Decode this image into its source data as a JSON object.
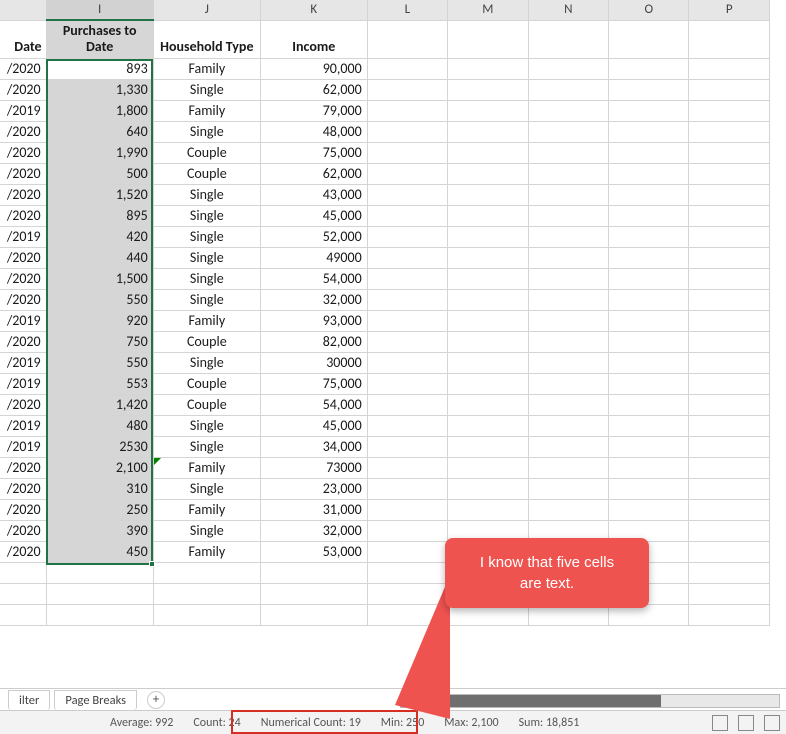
{
  "column_headers": [
    "I",
    "J",
    "K",
    "L",
    "M",
    "N",
    "O",
    "P"
  ],
  "selected_column": "I",
  "data_headers": {
    "date": "Date",
    "purchases": "Purchases to Date",
    "household": "Household Type",
    "income": "Income"
  },
  "rows": [
    {
      "date": "/2020",
      "p": "893",
      "h": "Family",
      "i": "90,000"
    },
    {
      "date": "/2020",
      "p": "1,330",
      "h": "Single",
      "i": "62,000"
    },
    {
      "date": "/2019",
      "p": "1,800",
      "h": "Family",
      "i": "79,000"
    },
    {
      "date": "/2020",
      "p": "640",
      "h": "Single",
      "i": "48,000"
    },
    {
      "date": "/2020",
      "p": "1,990",
      "h": "Couple",
      "i": "75,000"
    },
    {
      "date": "/2020",
      "p": "500",
      "h": "Couple",
      "i": "62,000"
    },
    {
      "date": "/2020",
      "p": "1,520",
      "h": "Single",
      "i": "43,000"
    },
    {
      "date": "/2020",
      "p": "895",
      "h": "Single",
      "i": "45,000"
    },
    {
      "date": "/2019",
      "p": "420",
      "h": "Single",
      "i": "52,000"
    },
    {
      "date": "/2020",
      "p": "440",
      "h": "Single",
      "i": "49000"
    },
    {
      "date": "/2020",
      "p": "1,500",
      "h": "Single",
      "i": "54,000"
    },
    {
      "date": "/2020",
      "p": "550",
      "h": "Single",
      "i": "32,000"
    },
    {
      "date": "/2019",
      "p": "920",
      "h": "Family",
      "i": "93,000"
    },
    {
      "date": "/2020",
      "p": "750",
      "h": "Couple",
      "i": "82,000"
    },
    {
      "date": "/2019",
      "p": "550",
      "h": "Single",
      "i": "30000"
    },
    {
      "date": "/2019",
      "p": "553",
      "h": "Couple",
      "i": "75,000"
    },
    {
      "date": "/2020",
      "p": "1,420",
      "h": "Couple",
      "i": "54,000"
    },
    {
      "date": "/2019",
      "p": "480",
      "h": "Single",
      "i": "45,000"
    },
    {
      "date": "/2019",
      "p": "2530",
      "h": "Single",
      "i": "34,000"
    },
    {
      "date": "/2020",
      "p": "2,100",
      "h": "Family",
      "i": "73000",
      "err": true
    },
    {
      "date": "/2020",
      "p": "310",
      "h": "Single",
      "i": "23,000"
    },
    {
      "date": "/2020",
      "p": "250",
      "h": "Family",
      "i": "31,000"
    },
    {
      "date": "/2020",
      "p": "390",
      "h": "Single",
      "i": "32,000"
    },
    {
      "date": "/2020",
      "p": "450",
      "h": "Family",
      "i": "53,000"
    }
  ],
  "tabs": {
    "filter": "ilter",
    "page_breaks": "Page Breaks"
  },
  "status": {
    "average": "Average:  992",
    "count": "Count: 24",
    "num_count": "Numerical Count: 19",
    "min": "Min: 250",
    "max": "Max: 2,100",
    "sum": "Sum: 18,851"
  },
  "callout": {
    "line1": "I know that five cells",
    "line2": "are text."
  }
}
